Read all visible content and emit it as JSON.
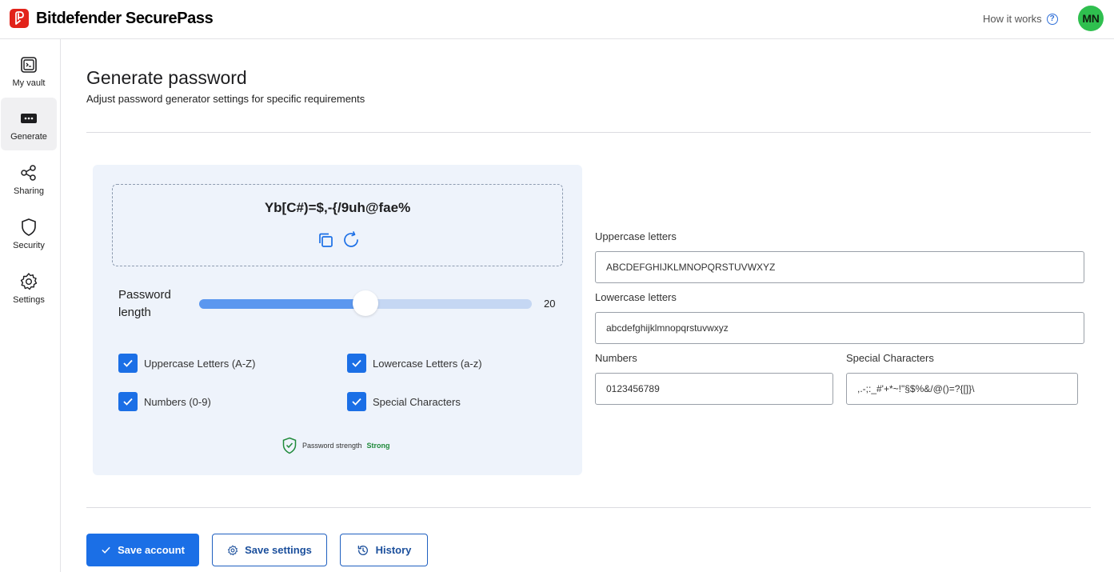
{
  "header": {
    "brand": "Bitdefender SecurePass",
    "how_it_works": "How it works",
    "avatar_initials": "MN"
  },
  "sidebar": {
    "items": [
      {
        "label": "My vault",
        "icon": "vault-icon"
      },
      {
        "label": "Generate",
        "icon": "password-dots-icon",
        "active": true
      },
      {
        "label": "Sharing",
        "icon": "share-icon"
      },
      {
        "label": "Security",
        "icon": "shield-icon"
      },
      {
        "label": "Settings",
        "icon": "gear-icon"
      }
    ]
  },
  "main": {
    "title": "Generate password",
    "subtitle": "Adjust password generator settings for specific requirements"
  },
  "generator": {
    "password": "Yb[C#)=$,-{/9uh@fae%",
    "length_label": "Password length",
    "length_value": "20",
    "length_fraction": 0.5,
    "options": [
      {
        "label": "Uppercase Letters (A-Z)",
        "checked": true
      },
      {
        "label": "Lowercase Letters (a-z)",
        "checked": true
      },
      {
        "label": "Numbers (0-9)",
        "checked": true
      },
      {
        "label": "Special Characters",
        "checked": true
      }
    ],
    "strength_label": "Password strength",
    "strength_value": "Strong"
  },
  "charsets": {
    "uppercase_label": "Uppercase letters",
    "uppercase_value": "ABCDEFGHIJKLMNOPQRSTUVWXYZ",
    "lowercase_label": "Lowercase letters",
    "lowercase_value": "abcdefghijklmnopqrstuvwxyz",
    "numbers_label": "Numbers",
    "numbers_value": "0123456789",
    "special_label": "Special Characters",
    "special_value": ",.-;:_#'+*~!\"§$%&/@()=?{[]}\\"
  },
  "actions": {
    "save_account": "Save account",
    "save_settings": "Save settings",
    "history": "History"
  },
  "colors": {
    "accent": "#1b6fe6",
    "brand_red": "#e2231a",
    "avatar_green": "#2fbf4f",
    "strength_green": "#1f8a3a",
    "card_bg": "#eef3fb"
  }
}
